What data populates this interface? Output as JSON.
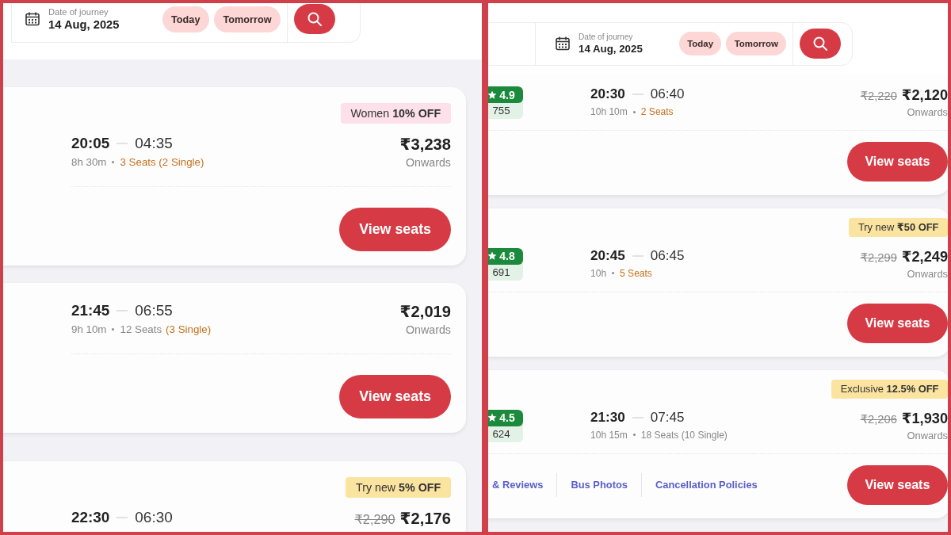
{
  "panels": [
    {
      "search": {
        "date_label": "Date of journey",
        "date": "14 Aug, 2025",
        "quick_dates": [
          "Today",
          "Tomorrow"
        ]
      },
      "buses": [
        {
          "offer": {
            "text": "Women **10% OFF**",
            "kind": "pink"
          },
          "departure": "20:05",
          "arrival": "04:35",
          "duration": "8h 30m",
          "seat_info": [
            {
              "text": "3 Seats (2 Single)",
              "highlight": true
            }
          ],
          "price": "₹3,238",
          "price_note": "Onwards",
          "button": "View seats"
        },
        {
          "departure": "21:45",
          "arrival": "06:55",
          "duration": "9h 10m",
          "seat_info": [
            {
              "text": "12 Seats",
              "highlight": false
            },
            {
              "text": "(3 Single)",
              "highlight": true
            }
          ],
          "price": "₹2,019",
          "price_note": "Onwards",
          "button": "View seats"
        },
        {
          "offer": {
            "text": "Try new **5% OFF**",
            "kind": "yellow"
          },
          "departure": "22:30",
          "arrival": "06:30",
          "old_price": "₹2,290",
          "price": "₹2,176"
        }
      ]
    },
    {
      "search": {
        "date_label": "Date of journey",
        "date": "14 Aug, 2025",
        "quick_dates": [
          "Today",
          "Tomorrow"
        ]
      },
      "buses": [
        {
          "rating": {
            "score": "4.9",
            "count": "755"
          },
          "departure": "20:30",
          "arrival": "06:40",
          "duration": "10h 10m",
          "seat_info": [
            {
              "text": "2 Seats",
              "highlight": true
            }
          ],
          "old_price": "₹2,220",
          "price": "₹2,120",
          "price_note": "Onwards",
          "button": "View seats"
        },
        {
          "offer": {
            "text": "Try new **₹50 OFF**",
            "kind": "yellow"
          },
          "rating": {
            "score": "4.8",
            "count": "691"
          },
          "departure": "20:45",
          "arrival": "06:45",
          "duration": "10h",
          "seat_info": [
            {
              "text": "5 Seats",
              "highlight": true
            }
          ],
          "old_price": "₹2,299",
          "price": "₹2,249",
          "price_note": "Onwards",
          "button": "View seats"
        },
        {
          "offer": {
            "text": "Exclusive **12.5% OFF**",
            "kind": "yellow"
          },
          "rating": {
            "score": "4.5",
            "count": "624"
          },
          "departure": "21:30",
          "arrival": "07:45",
          "duration": "10h 15m",
          "seat_info": [
            {
              "text": "18 Seats (10 Single)",
              "highlight": false
            }
          ],
          "old_price": "₹2,206",
          "price": "₹1,930",
          "price_note": "Onwards",
          "links": [
            "& Reviews",
            "Bus Photos",
            "Cancellation Policies"
          ],
          "button": "View seats"
        }
      ]
    }
  ]
}
